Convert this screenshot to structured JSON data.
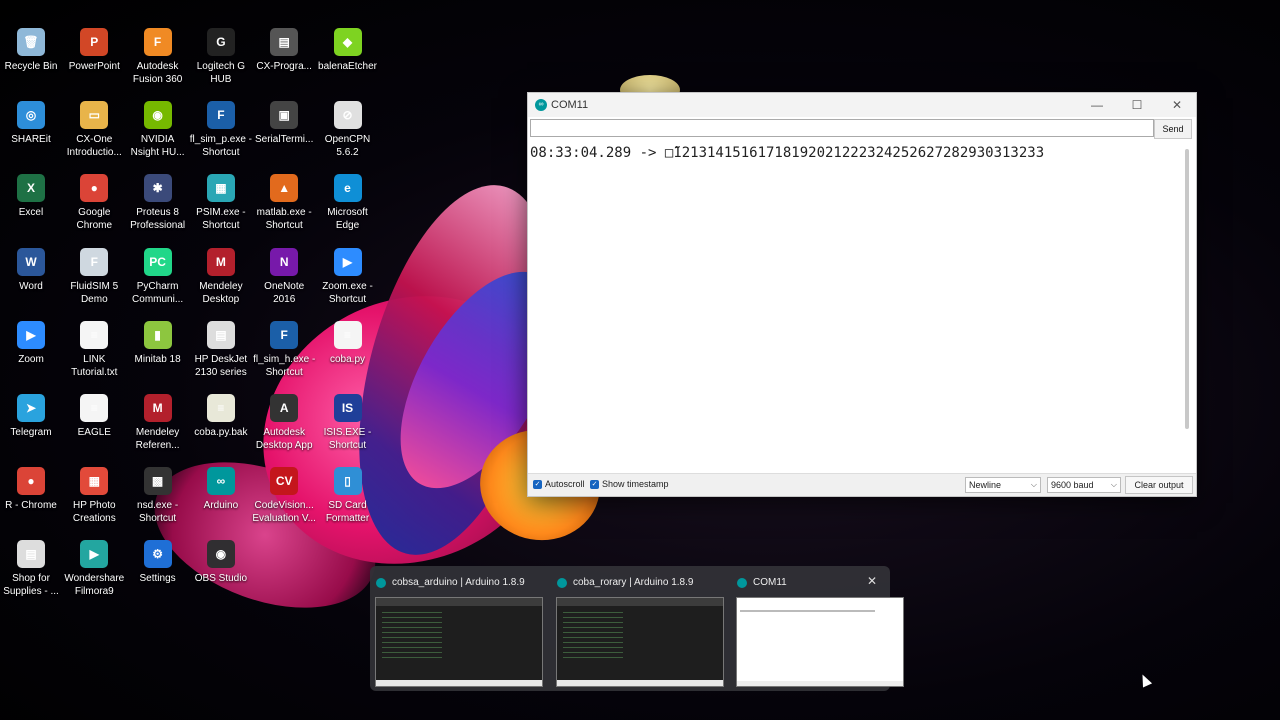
{
  "desktop": {
    "icons": [
      {
        "label": "Recycle Bin",
        "icon": "recycle-bin-icon",
        "glyph": "🗑",
        "color": "#8fb8d8"
      },
      {
        "label": "PowerPoint",
        "icon": "powerpoint-icon",
        "glyph": "P",
        "color": "#d24726"
      },
      {
        "label": "Autodesk\nFusion 360",
        "icon": "fusion-360-icon",
        "glyph": "F",
        "color": "#f08a24"
      },
      {
        "label": "Logitech G\nHUB",
        "icon": "logitech-g-hub-icon",
        "glyph": "G",
        "color": "#222222"
      },
      {
        "label": "CX-Progra...",
        "icon": "cx-programmer-icon",
        "glyph": "▤",
        "color": "#555555"
      },
      {
        "label": "balenaEtcher",
        "icon": "balena-etcher-icon",
        "glyph": "◆",
        "color": "#7ed321"
      },
      {
        "label": "SHAREit",
        "icon": "shareit-icon",
        "glyph": "◎",
        "color": "#2d8ed9"
      },
      {
        "label": "CX-One\nIntroductio...",
        "icon": "folder-icon",
        "glyph": "▭",
        "color": "#e8b44a"
      },
      {
        "label": "NVIDIA\nNsight HU...",
        "icon": "nvidia-nsight-icon",
        "glyph": "◉",
        "color": "#76b900"
      },
      {
        "label": "fl_sim_p.exe -\nShortcut",
        "icon": "festo-icon",
        "glyph": "F",
        "color": "#1b5fa8"
      },
      {
        "label": "SerialTermi...",
        "icon": "serial-terminal-icon",
        "glyph": "▣",
        "color": "#444444"
      },
      {
        "label": "OpenCPN\n5.6.2",
        "icon": "opencpn-icon",
        "glyph": "⊘",
        "color": "#e0e0e0"
      },
      {
        "label": "Excel",
        "icon": "excel-icon",
        "glyph": "X",
        "color": "#1e7145"
      },
      {
        "label": "Google\nChrome",
        "icon": "chrome-icon",
        "glyph": "●",
        "color": "#db4437"
      },
      {
        "label": "Proteus 8\nProfessional",
        "icon": "proteus-icon",
        "glyph": "✱",
        "color": "#3b4a7a"
      },
      {
        "label": "PSIM.exe -\nShortcut",
        "icon": "psim-icon",
        "glyph": "▦",
        "color": "#2aa7b5"
      },
      {
        "label": "matlab.exe -\nShortcut",
        "icon": "matlab-icon",
        "glyph": "▲",
        "color": "#e26a1d"
      },
      {
        "label": "Microsoft\nEdge",
        "icon": "edge-icon",
        "glyph": "e",
        "color": "#0f8fd6"
      },
      {
        "label": "Word",
        "icon": "word-icon",
        "glyph": "W",
        "color": "#2b579a"
      },
      {
        "label": "FluidSIM 5\nDemo",
        "icon": "fluidsim-icon",
        "glyph": "F",
        "color": "#cfd8e0"
      },
      {
        "label": "PyCharm\nCommuni...",
        "icon": "pycharm-icon",
        "glyph": "PC",
        "color": "#21d789"
      },
      {
        "label": "Mendeley\nDesktop",
        "icon": "mendeley-icon",
        "glyph": "M",
        "color": "#b3202c"
      },
      {
        "label": "OneNote\n2016",
        "icon": "onenote-icon",
        "glyph": "N",
        "color": "#7719aa"
      },
      {
        "label": "Zoom.exe -\nShortcut",
        "icon": "zoom-icon",
        "glyph": "▶",
        "color": "#2d8cff"
      },
      {
        "label": "Zoom",
        "icon": "zoom-icon",
        "glyph": "▶",
        "color": "#2d8cff"
      },
      {
        "label": "LINK\nTutorial.txt",
        "icon": "text-file-icon",
        "glyph": "≡",
        "color": "#f5f5f5"
      },
      {
        "label": "Minitab 18",
        "icon": "minitab-icon",
        "glyph": "▮",
        "color": "#8dc63f"
      },
      {
        "label": "HP DeskJet\n2130 series",
        "icon": "printer-icon",
        "glyph": "▤",
        "color": "#dddddd"
      },
      {
        "label": "fl_sim_h.exe -\nShortcut",
        "icon": "festo-icon",
        "glyph": "F",
        "color": "#1b5fa8"
      },
      {
        "label": "coba.py",
        "icon": "python-file-icon",
        "glyph": "≡",
        "color": "#f5f5f5"
      },
      {
        "label": "Telegram",
        "icon": "telegram-icon",
        "glyph": "➤",
        "color": "#2aa3de"
      },
      {
        "label": "EAGLE",
        "icon": "file-icon",
        "glyph": "≡",
        "color": "#f5f5f5"
      },
      {
        "label": "Mendeley\nReferen...",
        "icon": "mendeley-icon",
        "glyph": "M",
        "color": "#b3202c"
      },
      {
        "label": "coba.py.bak",
        "icon": "backup-file-icon",
        "glyph": "≡",
        "color": "#e8e8d8"
      },
      {
        "label": "Autodesk\nDesktop App",
        "icon": "autodesk-icon",
        "glyph": "A",
        "color": "#333333"
      },
      {
        "label": "ISIS.EXE -\nShortcut",
        "icon": "isis-icon",
        "glyph": "IS",
        "color": "#1f3f99"
      },
      {
        "label": "R - Chrome",
        "icon": "chrome-app-icon",
        "glyph": "●",
        "color": "#db4437"
      },
      {
        "label": "HP Photo\nCreations",
        "icon": "hp-photo-icon",
        "glyph": "▦",
        "color": "#e24a3a"
      },
      {
        "label": "nsd.exe -\nShortcut",
        "icon": "nsd-icon",
        "glyph": "▩",
        "color": "#333333"
      },
      {
        "label": "Arduino",
        "icon": "arduino-icon",
        "glyph": "∞",
        "color": "#00979c"
      },
      {
        "label": "CodeVision...\nEvaluation V...",
        "icon": "codevision-icon",
        "glyph": "CV",
        "color": "#c4161c"
      },
      {
        "label": "SD Card\nFormatter",
        "icon": "sd-card-icon",
        "glyph": "▯",
        "color": "#2f8fd6"
      },
      {
        "label": "Shop for\nSupplies - ...",
        "icon": "shop-icon",
        "glyph": "▤",
        "color": "#dddddd"
      },
      {
        "label": "Wondershare\nFilmora9",
        "icon": "filmora-icon",
        "glyph": "▶",
        "color": "#23a6a0"
      },
      {
        "label": "Settings",
        "icon": "settings-gear-icon",
        "glyph": "⚙",
        "color": "#1f6fd6"
      },
      {
        "label": "OBS Studio",
        "icon": "obs-icon",
        "glyph": "◉",
        "color": "#302e31"
      }
    ]
  },
  "window": {
    "title": "COM11",
    "input_value": "",
    "send_label": "Send",
    "output_line": "08:33:04.289 -> □̃12131415161718192021222324252627282930313233",
    "autoscroll_label": "Autoscroll",
    "autoscroll_checked": true,
    "timestamp_label": "Show timestamp",
    "timestamp_checked": true,
    "line_ending": "Newline",
    "baud": "9600 baud",
    "clear_label": "Clear output"
  },
  "task_switcher": {
    "items": [
      {
        "title": "cobsa_arduino | Arduino 1.8.9",
        "theme": "dark"
      },
      {
        "title": "coba_rorary | Arduino 1.8.9",
        "theme": "dark"
      },
      {
        "title": "COM11",
        "theme": "light"
      }
    ]
  }
}
